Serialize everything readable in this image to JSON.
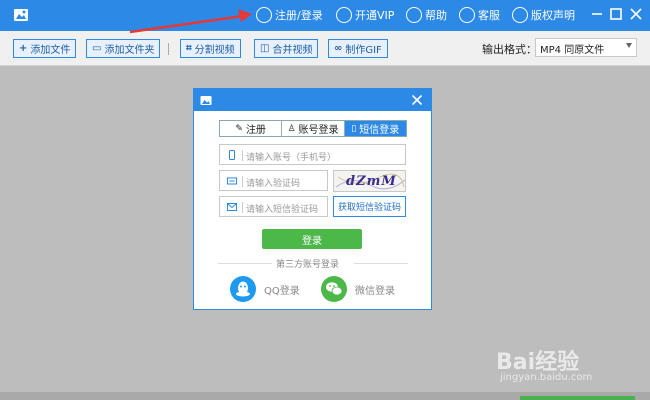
{
  "titlebar": {
    "items": [
      {
        "label": "注册/登录",
        "icon": "user-icon"
      },
      {
        "label": "开通VIP",
        "icon": "cart-icon"
      },
      {
        "label": "帮助",
        "icon": "chat-icon"
      },
      {
        "label": "客服",
        "icon": "headset-icon"
      },
      {
        "label": "版权声明",
        "icon": "copyright-icon"
      }
    ]
  },
  "toolbar": {
    "buttons": [
      {
        "label": "添加文件",
        "icon": "plus-icon"
      },
      {
        "label": "添加文件夹",
        "icon": "folder-icon"
      },
      {
        "label": "分割视频",
        "icon": "crop-icon"
      },
      {
        "label": "合并视频",
        "icon": "merge-icon"
      },
      {
        "label": "制作GIF",
        "icon": "gif-icon"
      }
    ],
    "format_label": "输出格式：",
    "format_value": "MP4  同原文件"
  },
  "dialog": {
    "tabs": [
      {
        "label": "注册",
        "icon": "pencil-icon"
      },
      {
        "label": "账号登录",
        "icon": "user-icon"
      },
      {
        "label": "短信登录",
        "icon": "phone-icon",
        "active": true
      }
    ],
    "account_placeholder": "请输入账号（手机号）",
    "captcha_placeholder": "请输入验证码",
    "captcha_text": "dZmM",
    "sms_placeholder": "请输入短信验证码",
    "sms_button": "获取短信验证码",
    "login_button": "登录",
    "third_party_label": "第三方账号登录",
    "qq_label": "QQ登录",
    "wechat_label": "微信登录"
  },
  "watermark": {
    "brand": "Bai经验",
    "url": "jingyan.baidu.com"
  },
  "colors": {
    "accent": "#2c89e6",
    "login_green": "#4cb84a",
    "qq_blue": "#1e9bf0",
    "wechat_green": "#4cb84a",
    "arrow_red": "#e53935"
  }
}
